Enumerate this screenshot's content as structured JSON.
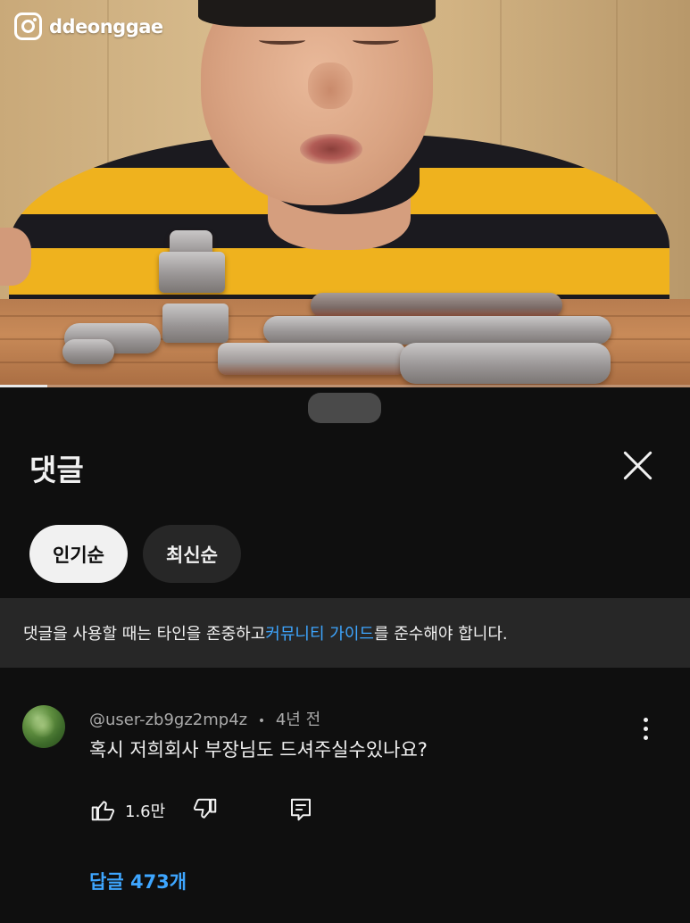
{
  "video": {
    "watermark_handle": "ddeonggae",
    "progress": 0.068
  },
  "comments_sheet": {
    "title": "댓글",
    "sort_chips": [
      {
        "label": "인기순",
        "selected": true
      },
      {
        "label": "최신순",
        "selected": false
      }
    ],
    "guideline": {
      "before": "댓글을 사용할 때는 타인을 존중하고 ",
      "link": "커뮤니티 가이드",
      "after": "를 준수해야 합니다."
    },
    "comment": {
      "author": "@user-zb9gz2mp4z",
      "separator": "•",
      "age": "4년 전",
      "text": "혹시 저희회사 부장님도 드셔주실수있나요?",
      "like_count": "1.6만",
      "replies_label": "답글 473개"
    }
  },
  "colors": {
    "background": "#0f0f0f",
    "surface": "#272727",
    "link": "#3ea6ff",
    "text": "#f1f1f1",
    "secondary_text": "#aaaaaa"
  },
  "icons": {
    "close": "close-icon",
    "like": "thumbs-up-icon",
    "dislike": "thumbs-down-icon",
    "reply": "reply-icon",
    "more": "more-vertical-icon",
    "instagram": "instagram-icon"
  }
}
